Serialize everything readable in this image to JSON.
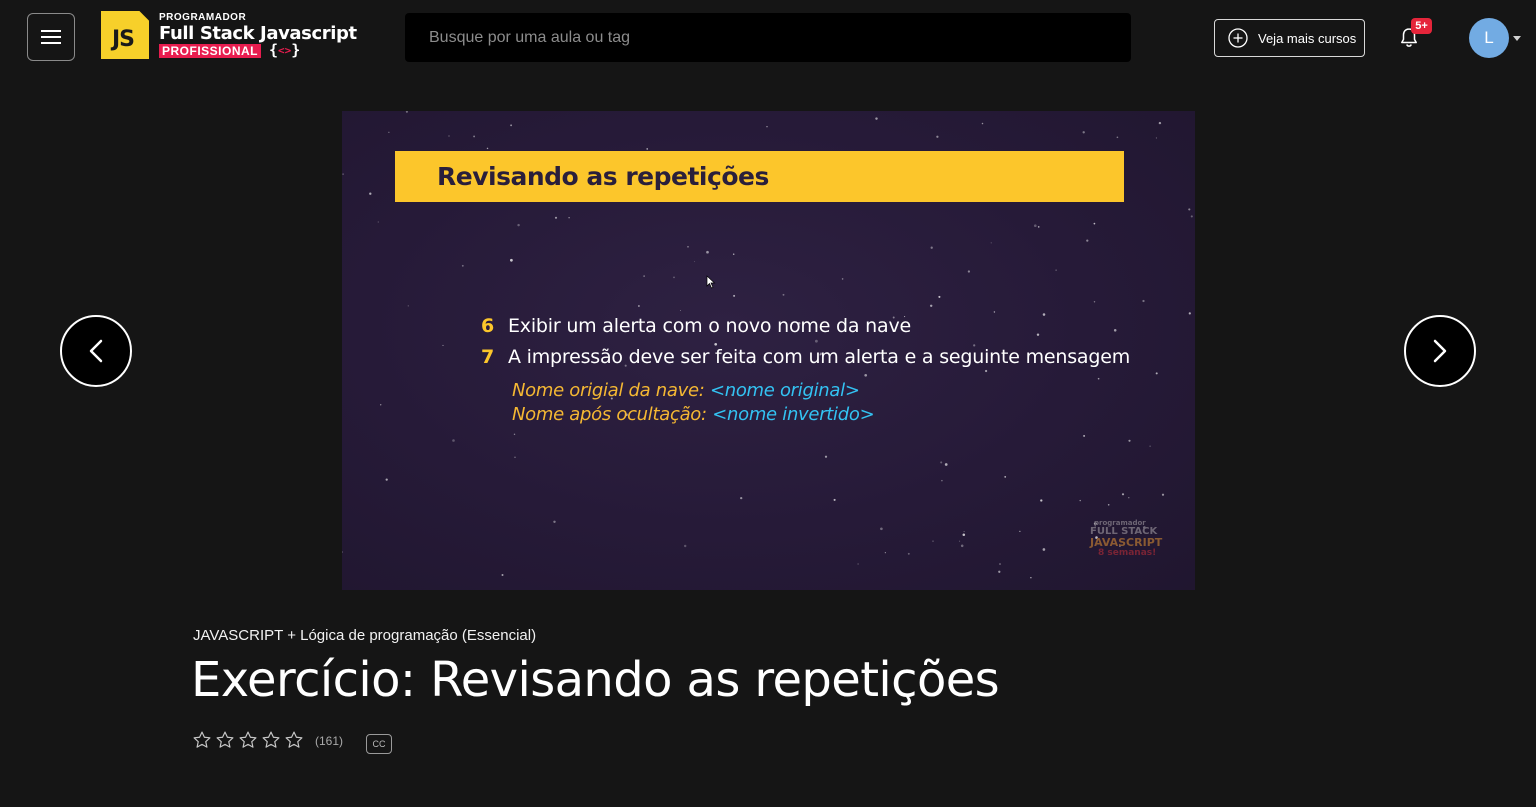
{
  "header": {
    "menu_icon": "hamburger-menu-icon",
    "logo": {
      "badge": "JS",
      "top": "PROGRAMADOR",
      "main": "Full Stack Javascript",
      "tag": "PROFISSIONAL",
      "brace_open": "{",
      "brace_mid": "<>",
      "brace_close": "}"
    },
    "search": {
      "placeholder": "Busque por uma aula ou tag",
      "value": ""
    },
    "more_courses": {
      "label": "Veja mais cursos",
      "icon": "plus-circle-icon"
    },
    "notifications": {
      "icon": "bell-icon",
      "count": "5+"
    },
    "user": {
      "initial": "L",
      "avatar_color": "#72abe3"
    }
  },
  "video": {
    "slide_title": "Revisando as repetições",
    "items": [
      {
        "number": "6",
        "text": "Exibir um alerta com o novo nome da nave"
      },
      {
        "number": "7",
        "text": "A impressão deve ser feita com um alerta e a seguinte mensagem"
      }
    ],
    "message": [
      {
        "label": "Nome origial da nave:",
        "code": "<nome original>"
      },
      {
        "label": "Nome após ocultação:",
        "code": "<nome invertido>"
      }
    ],
    "watermark": [
      "programador",
      "FULL STACK",
      "JAVASCRIPT",
      "8 semanas!"
    ]
  },
  "nav": {
    "prev_icon": "chevron-left-icon",
    "next_icon": "chevron-right-icon"
  },
  "lesson": {
    "course": "JAVASCRIPT + Lógica de programação (Essencial)",
    "title": "Exercício: Revisando as repetições",
    "rating_count": "(161)",
    "rating_value": 0,
    "max_stars": 5,
    "cc_label": "CC"
  },
  "colors": {
    "background": "#151515",
    "accent_yellow": "#fcc62b",
    "accent_red": "#e81d4f",
    "code_blue": "#33c2f2",
    "slide_bg": "#261a38"
  }
}
